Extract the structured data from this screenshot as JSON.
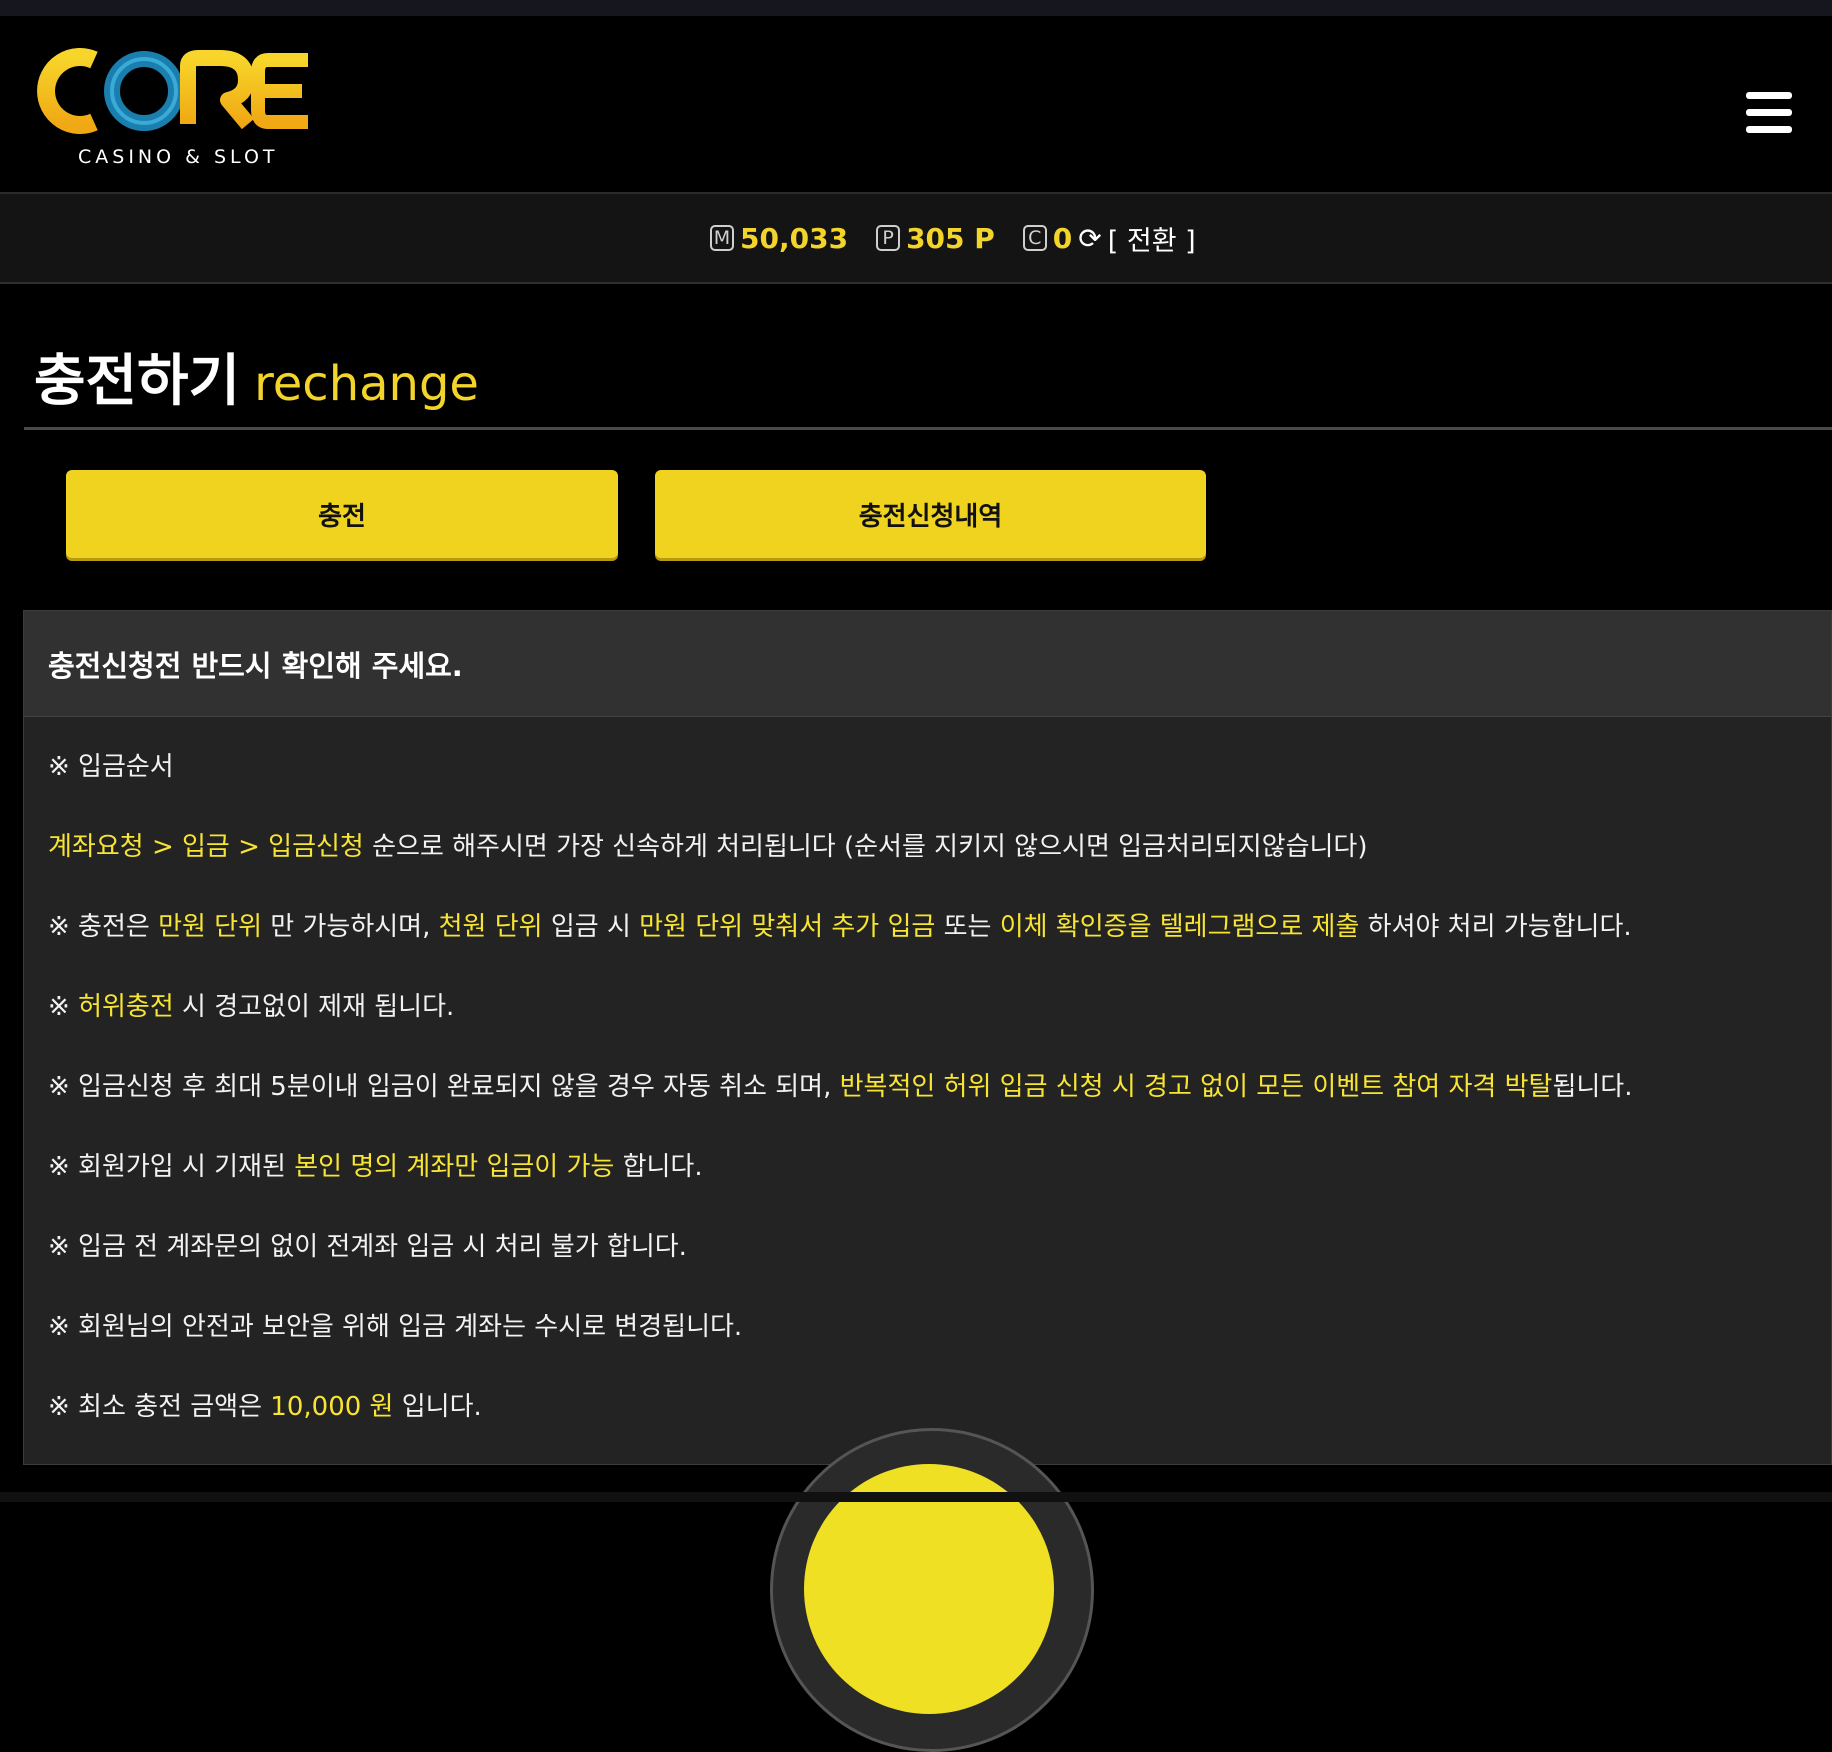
{
  "header": {
    "logo_text": "CORE",
    "logo_subtitle": "CASINO & SLOT"
  },
  "balance": {
    "money_badge": "M",
    "money": "50,033",
    "point_badge": "P",
    "point": "305 P",
    "coin_badge": "C",
    "coin": "0",
    "switch_label": "[ 전환 ]"
  },
  "page": {
    "title_ko": "충전하기",
    "title_en": "rechange"
  },
  "tabs": [
    {
      "label": "충전"
    },
    {
      "label": "충전신청내역"
    }
  ],
  "notice": {
    "heading": "충전신청전 반드시 확인해 주세요.",
    "line1": "※ 입금순서",
    "line2": {
      "hl1": "계좌요청 > 입금 > 입금신청",
      "t1": " 순으로 해주시면 가장 신속하게 처리됩니다 (순서를 지키지 않으시면 입금처리되지않습니다)"
    },
    "line3": {
      "t1": "※ 충전은 ",
      "hl1": "만원 단위",
      "t2": " 만 가능하시며, ",
      "hl2": "천원 단위",
      "t3": " 입금 시 ",
      "hl3": "만원 단위 맞춰서 추가 입금",
      "t4": " 또는 ",
      "hl4": "이체 확인증을 텔레그램으로 제출",
      "t5": " 하셔야 처리 가능합니다."
    },
    "line4": {
      "t1": "※ ",
      "hl1": "허위충전",
      "t2": " 시 경고없이 제재 됩니다."
    },
    "line5": {
      "t1": "※ 입금신청 후 최대 5분이내 입금이 완료되지 않을 경우 자동 취소 되며, ",
      "hl1": "반복적인 허위 입금 신청 시 경고 없이 모든 이벤트 참여 자격 박탈",
      "t2": "됩니다."
    },
    "line6": {
      "t1": "※ 회원가입 시 기재된 ",
      "hl1": "본인 명의 계좌만 입금이 가능",
      "t2": " 합니다."
    },
    "line7": "※ 입금 전 계좌문의 없이 전계좌 입금 시 처리 불가 합니다.",
    "line8": "※ 회원님의 안전과 보안을 위해 입금 계좌는 수시로 변경됩니다.",
    "line9": {
      "t1": "※ 최소 충전 금액은 ",
      "hl1": "10,000 원",
      "t2": " 입니다."
    }
  },
  "colors": {
    "accent_yellow": "#f0d31e",
    "highlight_text": "#f7e433",
    "logo_blue": "#1d86b5",
    "logo_gold": "#f4c21c"
  }
}
